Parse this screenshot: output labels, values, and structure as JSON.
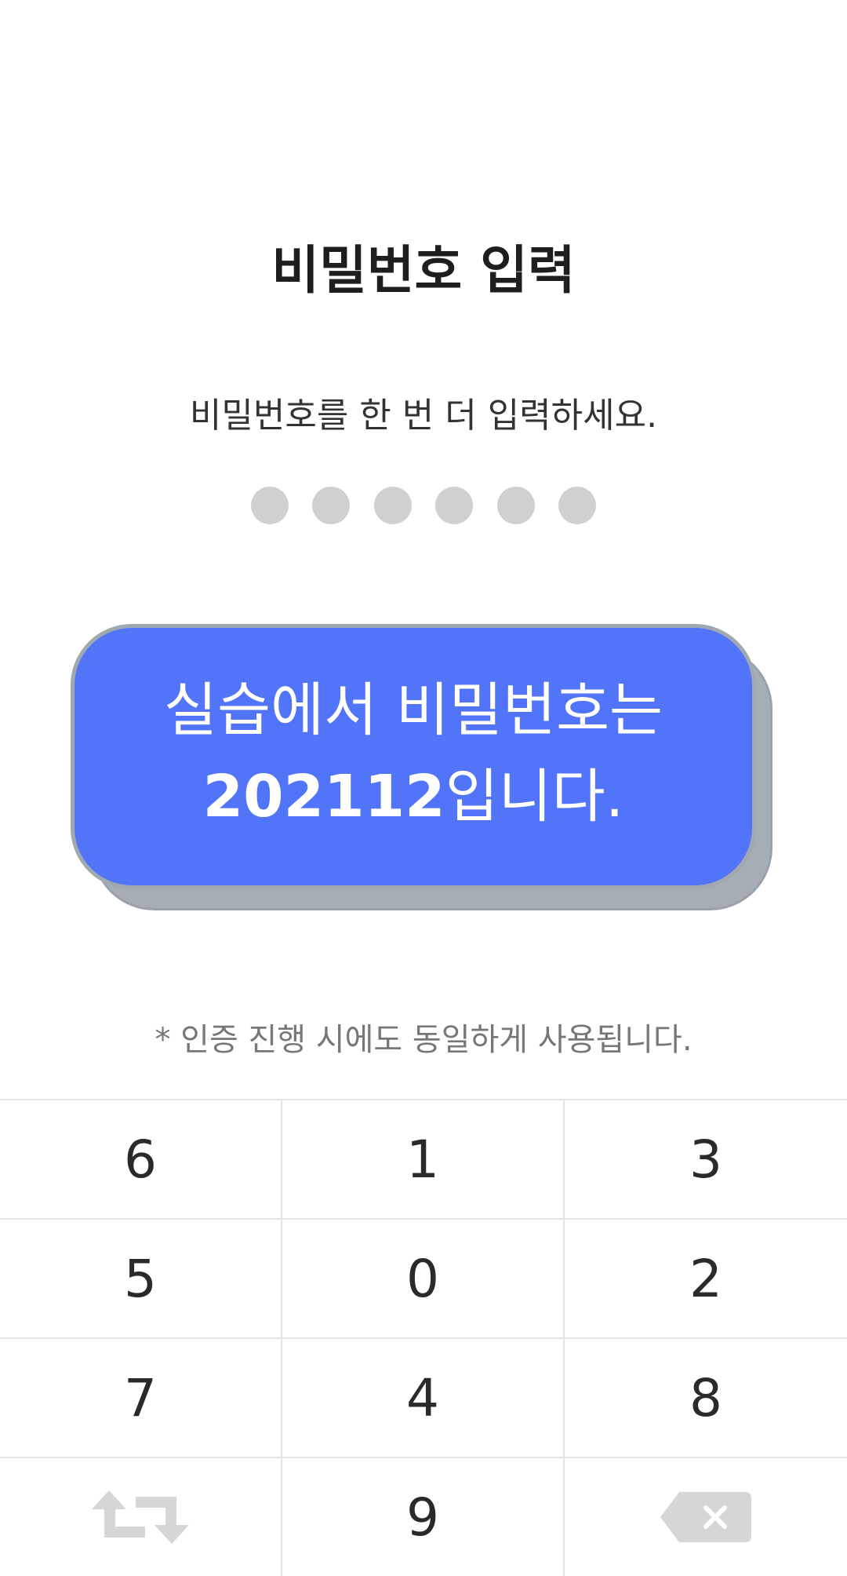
{
  "screen": {
    "title": "비밀번호 입력",
    "subtitle": "비밀번호를 한 번 더 입력하세요.",
    "pin_length": 6,
    "entered_digits": 0,
    "note": "* 인증 진행 시에도 동일하게 사용됩니다."
  },
  "callout": {
    "line1": "실습에서 비밀번호는",
    "code": "202112",
    "line2_suffix": "입니다."
  },
  "keypad": {
    "row1": [
      "6",
      "1",
      "3"
    ],
    "row2": [
      "5",
      "0",
      "2"
    ],
    "row3": [
      "7",
      "4",
      "8"
    ],
    "row4_center": "9",
    "shuffle_icon": "shuffle-icon",
    "backspace_icon": "backspace-icon"
  },
  "colors": {
    "callout_bg": "#5274f9",
    "dot_empty": "#d0d0d0",
    "icon_gray": "#d6d6d6"
  }
}
